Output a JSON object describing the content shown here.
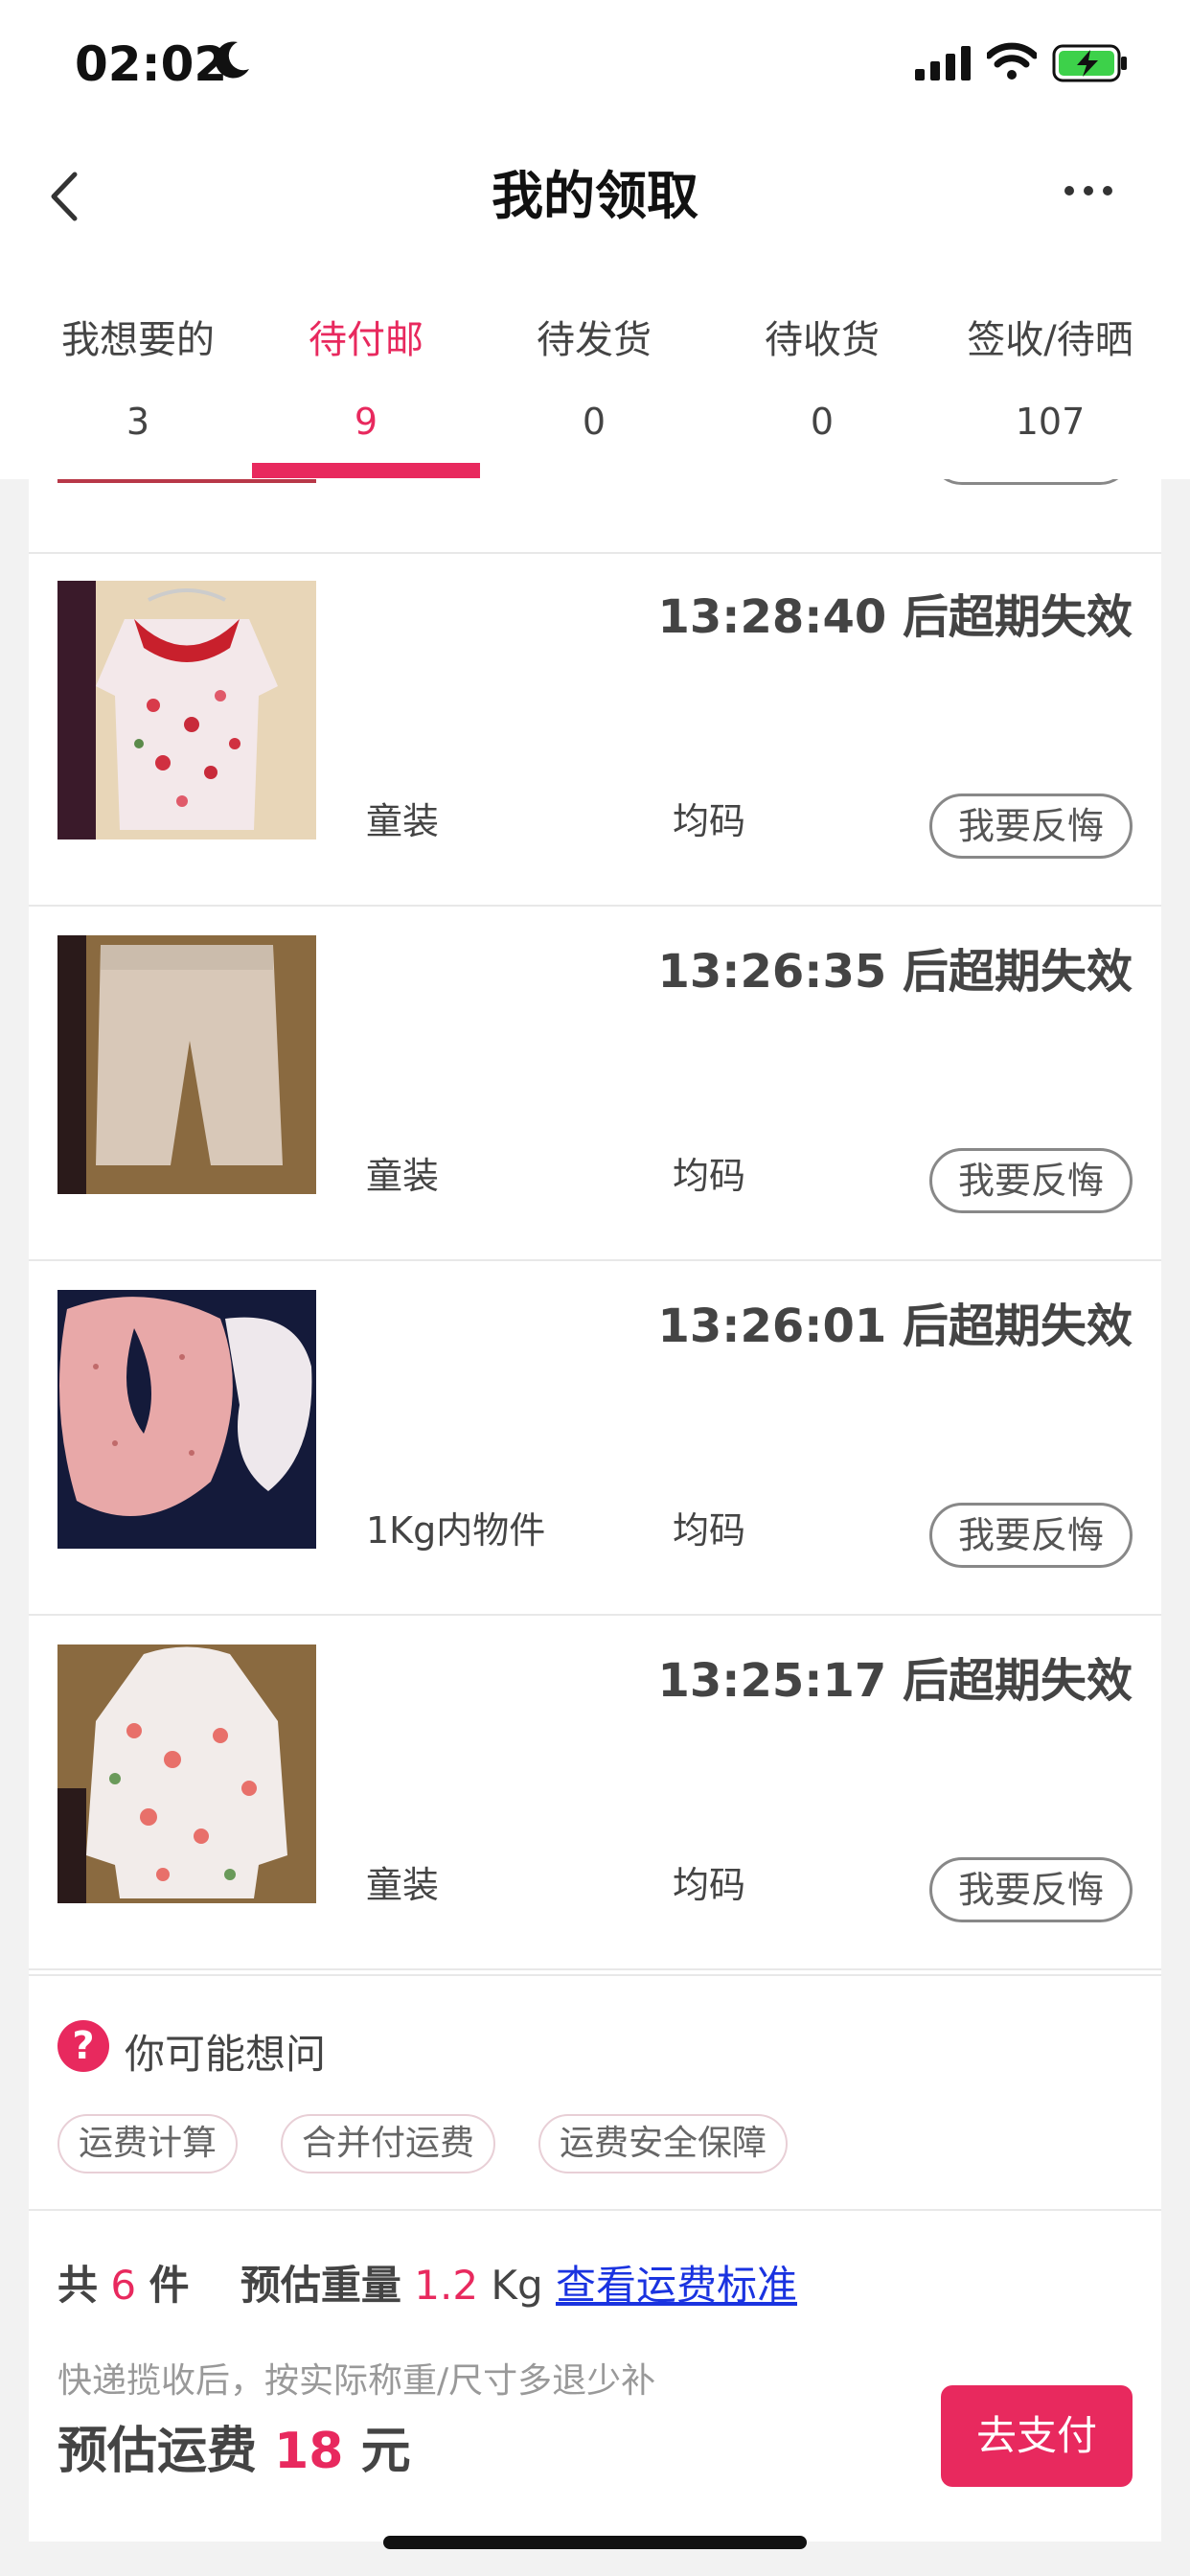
{
  "status_bar": {
    "time": "02:02"
  },
  "nav": {
    "title": "我的领取"
  },
  "tabs": [
    {
      "label": "我想要的",
      "count": "3"
    },
    {
      "label": "待付邮",
      "count": "9",
      "active": true
    },
    {
      "label": "待发货",
      "count": "0"
    },
    {
      "label": "待收货",
      "count": "0"
    },
    {
      "label": "签收/待晒",
      "count": "107"
    }
  ],
  "items": [
    {
      "countdown": "13:28:40 后超期失效",
      "category": "童装",
      "size": "均码",
      "action": "我要反悔",
      "image": "floral-baby-top"
    },
    {
      "countdown": "13:26:35 后超期失效",
      "category": "童装",
      "size": "均码",
      "action": "我要反悔",
      "image": "beige-baby-pants"
    },
    {
      "countdown": "13:26:01 后超期失效",
      "category": "1Kg内物件",
      "size": "均码",
      "action": "我要反悔",
      "image": "baby-bibs"
    },
    {
      "countdown": "13:25:17 后超期失效",
      "category": "童装",
      "size": "均码",
      "action": "我要反悔",
      "image": "floral-hooded-jacket"
    }
  ],
  "faq": {
    "title": "你可能想问",
    "chips": [
      "运费计算",
      "合并付运费",
      "运费安全保障"
    ]
  },
  "summary": {
    "count_prefix": "共",
    "count": "6",
    "count_suffix": "件",
    "weight_label": "预估重量",
    "weight": "1.2",
    "weight_unit": "Kg",
    "link": "查看运费标准",
    "note": "快递揽收后，按实际称重/尺寸多退少补",
    "fee_label": "预估运费",
    "fee": "18",
    "fee_unit": "元",
    "pay_button": "去支付"
  },
  "colors": {
    "accent": "#e8295e",
    "link": "#1a33e0"
  }
}
